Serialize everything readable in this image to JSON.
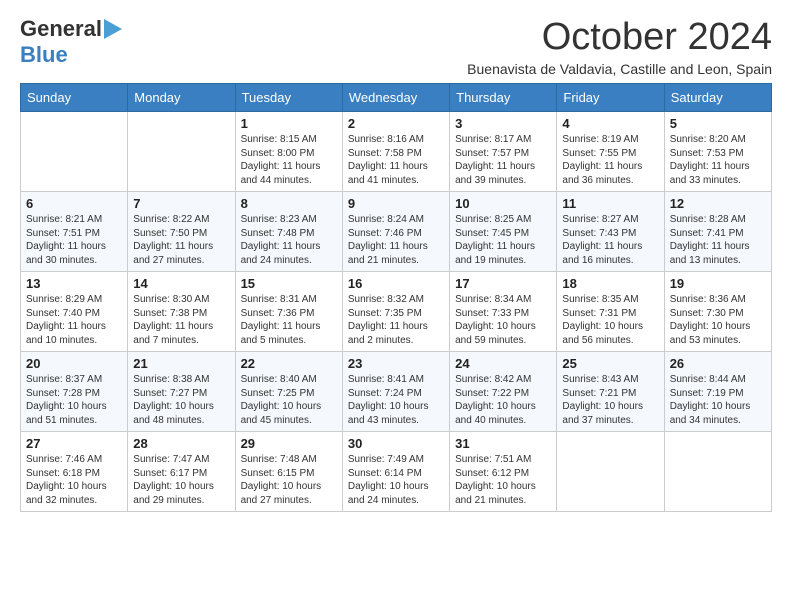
{
  "logo": {
    "line1": "General",
    "line2": "Blue",
    "arrow": "▶"
  },
  "title": "October 2024",
  "location": "Buenavista de Valdavia, Castille and Leon, Spain",
  "days_of_week": [
    "Sunday",
    "Monday",
    "Tuesday",
    "Wednesday",
    "Thursday",
    "Friday",
    "Saturday"
  ],
  "weeks": [
    [
      {
        "day": "",
        "sunrise": "",
        "sunset": "",
        "daylight": ""
      },
      {
        "day": "",
        "sunrise": "",
        "sunset": "",
        "daylight": ""
      },
      {
        "day": "1",
        "sunrise": "Sunrise: 8:15 AM",
        "sunset": "Sunset: 8:00 PM",
        "daylight": "Daylight: 11 hours and 44 minutes."
      },
      {
        "day": "2",
        "sunrise": "Sunrise: 8:16 AM",
        "sunset": "Sunset: 7:58 PM",
        "daylight": "Daylight: 11 hours and 41 minutes."
      },
      {
        "day": "3",
        "sunrise": "Sunrise: 8:17 AM",
        "sunset": "Sunset: 7:57 PM",
        "daylight": "Daylight: 11 hours and 39 minutes."
      },
      {
        "day": "4",
        "sunrise": "Sunrise: 8:19 AM",
        "sunset": "Sunset: 7:55 PM",
        "daylight": "Daylight: 11 hours and 36 minutes."
      },
      {
        "day": "5",
        "sunrise": "Sunrise: 8:20 AM",
        "sunset": "Sunset: 7:53 PM",
        "daylight": "Daylight: 11 hours and 33 minutes."
      }
    ],
    [
      {
        "day": "6",
        "sunrise": "Sunrise: 8:21 AM",
        "sunset": "Sunset: 7:51 PM",
        "daylight": "Daylight: 11 hours and 30 minutes."
      },
      {
        "day": "7",
        "sunrise": "Sunrise: 8:22 AM",
        "sunset": "Sunset: 7:50 PM",
        "daylight": "Daylight: 11 hours and 27 minutes."
      },
      {
        "day": "8",
        "sunrise": "Sunrise: 8:23 AM",
        "sunset": "Sunset: 7:48 PM",
        "daylight": "Daylight: 11 hours and 24 minutes."
      },
      {
        "day": "9",
        "sunrise": "Sunrise: 8:24 AM",
        "sunset": "Sunset: 7:46 PM",
        "daylight": "Daylight: 11 hours and 21 minutes."
      },
      {
        "day": "10",
        "sunrise": "Sunrise: 8:25 AM",
        "sunset": "Sunset: 7:45 PM",
        "daylight": "Daylight: 11 hours and 19 minutes."
      },
      {
        "day": "11",
        "sunrise": "Sunrise: 8:27 AM",
        "sunset": "Sunset: 7:43 PM",
        "daylight": "Daylight: 11 hours and 16 minutes."
      },
      {
        "day": "12",
        "sunrise": "Sunrise: 8:28 AM",
        "sunset": "Sunset: 7:41 PM",
        "daylight": "Daylight: 11 hours and 13 minutes."
      }
    ],
    [
      {
        "day": "13",
        "sunrise": "Sunrise: 8:29 AM",
        "sunset": "Sunset: 7:40 PM",
        "daylight": "Daylight: 11 hours and 10 minutes."
      },
      {
        "day": "14",
        "sunrise": "Sunrise: 8:30 AM",
        "sunset": "Sunset: 7:38 PM",
        "daylight": "Daylight: 11 hours and 7 minutes."
      },
      {
        "day": "15",
        "sunrise": "Sunrise: 8:31 AM",
        "sunset": "Sunset: 7:36 PM",
        "daylight": "Daylight: 11 hours and 5 minutes."
      },
      {
        "day": "16",
        "sunrise": "Sunrise: 8:32 AM",
        "sunset": "Sunset: 7:35 PM",
        "daylight": "Daylight: 11 hours and 2 minutes."
      },
      {
        "day": "17",
        "sunrise": "Sunrise: 8:34 AM",
        "sunset": "Sunset: 7:33 PM",
        "daylight": "Daylight: 10 hours and 59 minutes."
      },
      {
        "day": "18",
        "sunrise": "Sunrise: 8:35 AM",
        "sunset": "Sunset: 7:31 PM",
        "daylight": "Daylight: 10 hours and 56 minutes."
      },
      {
        "day": "19",
        "sunrise": "Sunrise: 8:36 AM",
        "sunset": "Sunset: 7:30 PM",
        "daylight": "Daylight: 10 hours and 53 minutes."
      }
    ],
    [
      {
        "day": "20",
        "sunrise": "Sunrise: 8:37 AM",
        "sunset": "Sunset: 7:28 PM",
        "daylight": "Daylight: 10 hours and 51 minutes."
      },
      {
        "day": "21",
        "sunrise": "Sunrise: 8:38 AM",
        "sunset": "Sunset: 7:27 PM",
        "daylight": "Daylight: 10 hours and 48 minutes."
      },
      {
        "day": "22",
        "sunrise": "Sunrise: 8:40 AM",
        "sunset": "Sunset: 7:25 PM",
        "daylight": "Daylight: 10 hours and 45 minutes."
      },
      {
        "day": "23",
        "sunrise": "Sunrise: 8:41 AM",
        "sunset": "Sunset: 7:24 PM",
        "daylight": "Daylight: 10 hours and 43 minutes."
      },
      {
        "day": "24",
        "sunrise": "Sunrise: 8:42 AM",
        "sunset": "Sunset: 7:22 PM",
        "daylight": "Daylight: 10 hours and 40 minutes."
      },
      {
        "day": "25",
        "sunrise": "Sunrise: 8:43 AM",
        "sunset": "Sunset: 7:21 PM",
        "daylight": "Daylight: 10 hours and 37 minutes."
      },
      {
        "day": "26",
        "sunrise": "Sunrise: 8:44 AM",
        "sunset": "Sunset: 7:19 PM",
        "daylight": "Daylight: 10 hours and 34 minutes."
      }
    ],
    [
      {
        "day": "27",
        "sunrise": "Sunrise: 7:46 AM",
        "sunset": "Sunset: 6:18 PM",
        "daylight": "Daylight: 10 hours and 32 minutes."
      },
      {
        "day": "28",
        "sunrise": "Sunrise: 7:47 AM",
        "sunset": "Sunset: 6:17 PM",
        "daylight": "Daylight: 10 hours and 29 minutes."
      },
      {
        "day": "29",
        "sunrise": "Sunrise: 7:48 AM",
        "sunset": "Sunset: 6:15 PM",
        "daylight": "Daylight: 10 hours and 27 minutes."
      },
      {
        "day": "30",
        "sunrise": "Sunrise: 7:49 AM",
        "sunset": "Sunset: 6:14 PM",
        "daylight": "Daylight: 10 hours and 24 minutes."
      },
      {
        "day": "31",
        "sunrise": "Sunrise: 7:51 AM",
        "sunset": "Sunset: 6:12 PM",
        "daylight": "Daylight: 10 hours and 21 minutes."
      },
      {
        "day": "",
        "sunrise": "",
        "sunset": "",
        "daylight": ""
      },
      {
        "day": "",
        "sunrise": "",
        "sunset": "",
        "daylight": ""
      }
    ]
  ]
}
